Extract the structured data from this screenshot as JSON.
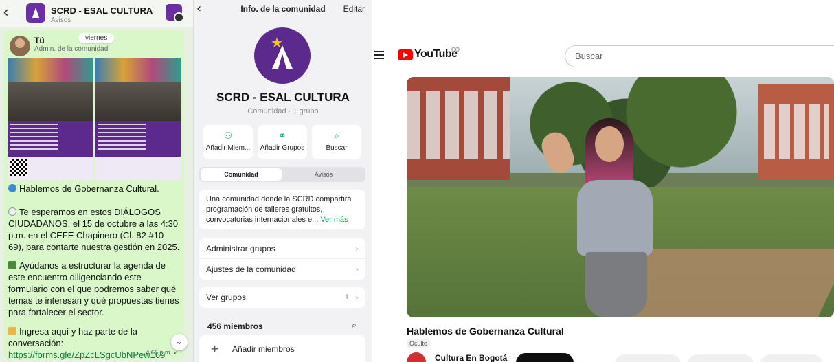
{
  "chat": {
    "group_name": "SCRD - ESAL CULTURA",
    "group_sub": "Avisos",
    "sender": "Tú",
    "role": "Admin. de la comunidad",
    "day": "viernes",
    "p1": "Hablemos de Gobernanza Cultural.",
    "p2": "Te esperamos en estos DIÁLOGOS CIUDADANOS, el 15 de octubre a las 4:30 p.m. en el CEFE Chapinero (Cl. 82 #10-69), para contarte nuestra gestión en 2025.",
    "p3": "Ayúdanos a estructurar la agenda de este encuentro diligenciando este formulario con el que podremos saber qué temas te interesan y qué propuestas tienes para fortalecer el sector.",
    "p4": "Ingresa aquí y haz parte de la conversación:",
    "link": "https://forms.gle/ZpZcLSgcUbNPew169",
    "time": "4:56 p.m. ✓"
  },
  "info": {
    "header_title": "Info. de la comunidad",
    "edit": "Editar",
    "name": "SCRD - ESAL CULTURA",
    "sub": "Comunidad · 1 grupo",
    "actions": [
      {
        "icon": "add-member-icon",
        "glyph": "⚇",
        "label": "Añadir Miem..."
      },
      {
        "icon": "add-groups-icon",
        "glyph": "⚭",
        "label": "Añadir Grupos"
      },
      {
        "icon": "search-icon",
        "glyph": "⌕",
        "label": "Buscar"
      }
    ],
    "tabs": [
      "Comunidad",
      "Avisos"
    ],
    "description": "Una comunidad donde la SCRD compartirá programación de talleres gratuitos, convocatorias internacionales e...",
    "see_more": "Ver más",
    "rows": [
      "Administrar grupos",
      "Ajustes de la comunidad"
    ],
    "groups_row": "Ver grupos",
    "groups_count": "1",
    "members": "456 miembros",
    "add_members": "Añadir miembros"
  },
  "youtube": {
    "logo": "YouTube",
    "country": "CO",
    "search_placeholder": "Buscar",
    "video_title": "Hablemos de Gobernanza Cultural",
    "visibility": "Oculto",
    "channel": "Cultura En Bogotá"
  },
  "colors": {
    "chat_bubble": "#d9f7c9",
    "whatsapp_green": "#1fa35a",
    "community_purple": "#5b2a8c",
    "youtube_red": "#ff0000"
  }
}
